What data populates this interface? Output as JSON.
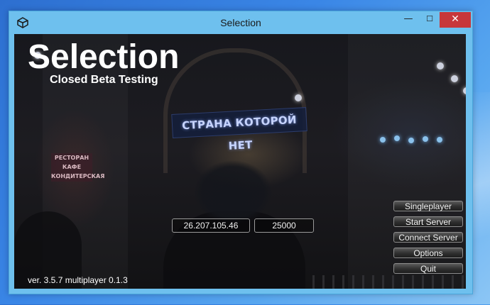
{
  "window": {
    "title": "Selection",
    "minimize_glyph": "—",
    "maximize_glyph": "☐",
    "close_glyph": "✕"
  },
  "background": {
    "sign_main": "СТРАНА КОТОРОЙ НЕТ",
    "sign_small": "РЕСТОРАН КАФЕ КОНДИТЕРСКАЯ"
  },
  "game": {
    "title": "Selection",
    "subtitle": "Closed Beta Testing",
    "ip_value": "26.207.105.46",
    "port_value": "25000",
    "version": "ver. 3.5.7 multiplayer 0.1.3"
  },
  "menu": {
    "singleplayer": "Singleplayer",
    "start_server": "Start Server",
    "connect_server": "Connect Server",
    "options": "Options",
    "quit": "Quit"
  },
  "colors": {
    "window_frame": "#6ec0ee",
    "close_button": "#c7373a",
    "desktop": "#3a86e6"
  },
  "icons": {
    "app": "unity-logo-icon"
  }
}
